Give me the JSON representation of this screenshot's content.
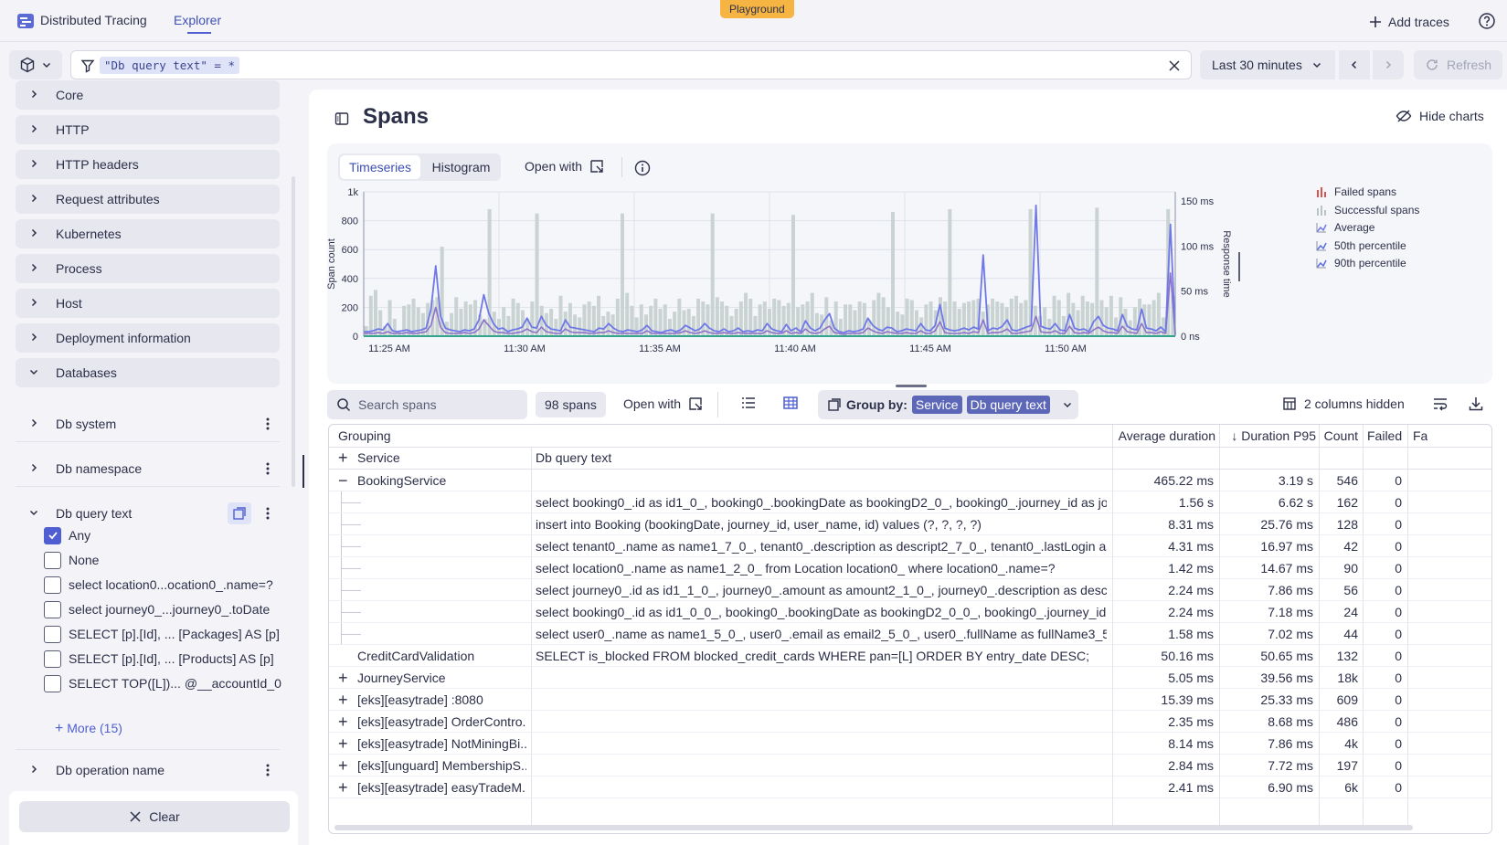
{
  "topbar": {
    "app_name": "Distributed Tracing",
    "explorer_tab": "Explorer",
    "playground": "Playground",
    "add_traces": "Add traces"
  },
  "filter": {
    "chip": "\"Db query text\" = *",
    "time_range": "Last 30 minutes",
    "refresh": "Refresh"
  },
  "sidebar": {
    "facets": [
      "Core",
      "HTTP",
      "HTTP headers",
      "Request attributes",
      "Kubernetes",
      "Process",
      "Host",
      "Deployment information",
      "Databases"
    ],
    "sub_facets": {
      "db_system": "Db system",
      "db_namespace": "Db namespace",
      "db_query_text": "Db query text",
      "db_operation_name": "Db operation name"
    },
    "query_options": [
      {
        "label": "Any",
        "checked": true
      },
      {
        "label": "None",
        "checked": false
      },
      {
        "label": "select location0...ocation0_.name=?",
        "checked": false
      },
      {
        "label": "select journey0_...journey0_.toDate",
        "checked": false
      },
      {
        "label": "SELECT [p].[Id], ... [Packages] AS [p]",
        "checked": false
      },
      {
        "label": "SELECT [p].[Id], ... [Products] AS [p]",
        "checked": false
      },
      {
        "label": "SELECT TOP([L])... @__accountId_0",
        "checked": false
      }
    ],
    "more": "More (15)",
    "clear": "Clear"
  },
  "main": {
    "title": "Spans",
    "hide_charts": "Hide charts",
    "tabs": [
      "Timeseries",
      "Histogram"
    ],
    "open_with": "Open with"
  },
  "chart_data": {
    "type": "bar",
    "left_axis": {
      "label": "Span count",
      "ticks": [
        "1k",
        "800",
        "600",
        "400",
        "200",
        "0"
      ],
      "range": [
        0,
        1000
      ]
    },
    "right_axis": {
      "label": "Response time",
      "ticks": [
        "150 ms",
        "100 ms",
        "50 ms",
        "0 ns"
      ],
      "range": [
        0,
        160
      ]
    },
    "x_ticks": [
      "11:25 AM",
      "11:30 AM",
      "11:35 AM",
      "11:40 AM",
      "11:45 AM",
      "11:50 AM"
    ],
    "grid": true,
    "legend_position": "right",
    "legend": [
      "Failed spans",
      "Successful spans",
      "Average",
      "50th percentile",
      "90th percentile"
    ],
    "colors": {
      "bars": "#c9d3d1",
      "average": "#6f78e8",
      "p50": "#8e72c9",
      "p90": "#5b6ee0",
      "failed": "#d9534f"
    },
    "series": [
      {
        "name": "Successful spans",
        "values": [
          70,
          280,
          320,
          180,
          70,
          250,
          120,
          40,
          210,
          220,
          260,
          200,
          160,
          230,
          250,
          270,
          620,
          100,
          160,
          270,
          190,
          240,
          220,
          250,
          150,
          120,
          880,
          170,
          120,
          200,
          140,
          260,
          230,
          180,
          120,
          240,
          850,
          210,
          160,
          190,
          120,
          280,
          170,
          230,
          150,
          130,
          220,
          240,
          210,
          280,
          140,
          170,
          150,
          260,
          850,
          300,
          210,
          130,
          220,
          150,
          210,
          260,
          190,
          220,
          120,
          170,
          260,
          180,
          190,
          140,
          260,
          240,
          220,
          850,
          270,
          240,
          210,
          140,
          190,
          240,
          300,
          260,
          140,
          220,
          240,
          190,
          260,
          250,
          210,
          230,
          840,
          200,
          220,
          240,
          300,
          160,
          150,
          270,
          110,
          240,
          120,
          220,
          220,
          180,
          240,
          230,
          110,
          250,
          300,
          270,
          200,
          860,
          170,
          150,
          260,
          250,
          180,
          130,
          220,
          240,
          180,
          270,
          240,
          880,
          240,
          190,
          230,
          240,
          250,
          260,
          170,
          220,
          260,
          240,
          230,
          200,
          260,
          280,
          230,
          250,
          880,
          210,
          140,
          200,
          120,
          280,
          250,
          140,
          300,
          230,
          180,
          280,
          240,
          230,
          890,
          250,
          200,
          280,
          130,
          270,
          190,
          110,
          200,
          260,
          220,
          220,
          250,
          300,
          130,
          880,
          280
        ]
      },
      {
        "name": "Average",
        "values": [
          5,
          5,
          6,
          8,
          7,
          14,
          6,
          5,
          6,
          7,
          5,
          6,
          7,
          9,
          30,
          78,
          22,
          9,
          7,
          6,
          5,
          7,
          6,
          8,
          18,
          46,
          26,
          14,
          8,
          9,
          5,
          7,
          8,
          10,
          20,
          10,
          9,
          22,
          12,
          8,
          7,
          6,
          18,
          10,
          9,
          8,
          7,
          6,
          5,
          9,
          8,
          14,
          9,
          6,
          5,
          7,
          6,
          5,
          7,
          12,
          6,
          5,
          4,
          6,
          7,
          5,
          7,
          12,
          9,
          6,
          8,
          14,
          9,
          6,
          5,
          8,
          5,
          6,
          9,
          5,
          6,
          5,
          7,
          6,
          14,
          8,
          6,
          5,
          13,
          6,
          9,
          5,
          17,
          9,
          6,
          9,
          18,
          25,
          9,
          5,
          4,
          6,
          5,
          6,
          8,
          20,
          12,
          8,
          6,
          10,
          9,
          5,
          6,
          8,
          7,
          6,
          14,
          7,
          6,
          12,
          35,
          9,
          7,
          6,
          7,
          9,
          7,
          10,
          8,
          90,
          6,
          9,
          8,
          11,
          18,
          7,
          6,
          8,
          10,
          12,
          145,
          11,
          9,
          8,
          14,
          7,
          6,
          24,
          9,
          7,
          8,
          5,
          16,
          22,
          12,
          9,
          8,
          6,
          24,
          11,
          8,
          7,
          30,
          9,
          8,
          6,
          10,
          5,
          124,
          2
        ]
      },
      {
        "name": "50th percentile",
        "values": [
          3,
          3,
          3,
          4,
          3,
          5,
          3,
          3,
          3,
          4,
          3,
          3,
          4,
          5,
          12,
          32,
          10,
          4,
          3,
          3,
          3,
          4,
          3,
          4,
          8,
          18,
          12,
          6,
          4,
          4,
          3,
          3,
          4,
          5,
          8,
          5,
          4,
          10,
          5,
          4,
          3,
          3,
          8,
          5,
          4,
          4,
          4,
          3,
          3,
          4,
          4,
          6,
          4,
          3,
          3,
          3,
          3,
          3,
          3,
          6,
          3,
          3,
          3,
          3,
          3,
          3,
          4,
          6,
          4,
          3,
          4,
          6,
          4,
          3,
          3,
          4,
          3,
          3,
          4,
          3,
          3,
          3,
          3,
          3,
          6,
          4,
          3,
          3,
          6,
          3,
          4,
          3,
          8,
          4,
          3,
          4,
          8,
          11,
          4,
          3,
          2,
          3,
          3,
          3,
          4,
          9,
          6,
          4,
          3,
          5,
          4,
          3,
          3,
          4,
          3,
          3,
          6,
          3,
          3,
          6,
          16,
          4,
          3,
          3,
          3,
          4,
          3,
          5,
          4,
          18,
          3,
          4,
          4,
          5,
          8,
          3,
          3,
          4,
          5,
          6,
          22,
          5,
          4,
          4,
          6,
          3,
          3,
          11,
          4,
          3,
          4,
          3,
          7,
          10,
          6,
          4,
          4,
          3,
          11,
          5,
          4,
          3,
          14,
          4,
          4,
          3,
          5,
          3,
          70,
          1
        ]
      }
    ]
  },
  "table_toolbar": {
    "search_placeholder": "Search spans",
    "span_count": "98 spans",
    "open_with": "Open with",
    "group_by_label": "Group by:",
    "group_by_chips": [
      "Service",
      "Db query text"
    ],
    "columns_hidden": "2 columns hidden"
  },
  "table": {
    "headers": {
      "grouping": "Grouping",
      "service": "Service",
      "db_query_text": "Db query text",
      "avg_duration": "Average duration",
      "p95": "Duration P95",
      "count": "Count",
      "failed": "Failed",
      "extra": "Fa"
    },
    "rows": [
      {
        "expander": "minus",
        "service": "BookingService",
        "query": "",
        "avg": "465.22 ms",
        "p95": "3.19 s",
        "count": "546",
        "failed": "0",
        "indent": 0
      },
      {
        "expander": "",
        "service": "",
        "query": "select booking0_.id as id1_0_, booking0_.bookingDate as bookingD2_0_, booking0_.journey_id as journ...",
        "avg": "1.56 s",
        "p95": "6.62 s",
        "count": "162",
        "failed": "0",
        "indent": 1
      },
      {
        "expander": "",
        "service": "",
        "query": "insert into Booking (bookingDate, journey_id, user_name, id) values (?, ?, ?, ?)",
        "avg": "8.31 ms",
        "p95": "25.76 ms",
        "count": "128",
        "failed": "0",
        "indent": 1
      },
      {
        "expander": "",
        "service": "",
        "query": "select tenant0_.name as name1_7_0_, tenant0_.description as descript2_7_0_, tenant0_.lastLogin as ...",
        "avg": "4.31 ms",
        "p95": "16.97 ms",
        "count": "42",
        "failed": "0",
        "indent": 1
      },
      {
        "expander": "",
        "service": "",
        "query": "select location0_.name as name1_2_0_ from Location location0_ where location0_.name=?",
        "avg": "1.42 ms",
        "p95": "14.67 ms",
        "count": "90",
        "failed": "0",
        "indent": 1
      },
      {
        "expander": "",
        "service": "",
        "query": "select journey0_.id as id1_1_0_, journey0_.amount as amount2_1_0_, journey0_.description as descri...",
        "avg": "2.24 ms",
        "p95": "7.86 ms",
        "count": "56",
        "failed": "0",
        "indent": 1
      },
      {
        "expander": "",
        "service": "",
        "query": "select booking0_.id as id1_0_0_, booking0_.bookingDate as bookingD2_0_0_, booking0_.journey_id as j...",
        "avg": "2.24 ms",
        "p95": "7.18 ms",
        "count": "24",
        "failed": "0",
        "indent": 1
      },
      {
        "expander": "",
        "service": "",
        "query": "select user0_.name as name1_5_0_, user0_.email as email2_5_0_, user0_.fullName as fullName3_5_...",
        "avg": "1.58 ms",
        "p95": "7.02 ms",
        "count": "44",
        "failed": "0",
        "indent": 1
      },
      {
        "expander": "",
        "service": "CreditCardValidation",
        "query": "SELECT is_blocked FROM blocked_credit_cards WHERE pan=[L] ORDER BY entry_date DESC;",
        "avg": "50.16 ms",
        "p95": "50.65 ms",
        "count": "132",
        "failed": "0",
        "indent": 0
      },
      {
        "expander": "plus",
        "service": "JourneyService",
        "query": "",
        "avg": "5.05 ms",
        "p95": "39.56 ms",
        "count": "18k",
        "failed": "0",
        "indent": 0
      },
      {
        "expander": "plus",
        "service": "[eks][easytrade] :8080",
        "query": "",
        "avg": "15.39 ms",
        "p95": "25.33 ms",
        "count": "609",
        "failed": "0",
        "indent": 0
      },
      {
        "expander": "plus",
        "service": "[eks][easytrade] OrderContro...",
        "query": "",
        "avg": "2.35 ms",
        "p95": "8.68 ms",
        "count": "486",
        "failed": "0",
        "indent": 0
      },
      {
        "expander": "plus",
        "service": "[eks][easytrade] NotMiningBi...",
        "query": "",
        "avg": "8.14 ms",
        "p95": "7.86 ms",
        "count": "4k",
        "failed": "0",
        "indent": 0
      },
      {
        "expander": "plus",
        "service": "[eks][unguard] MembershipS...",
        "query": "",
        "avg": "2.84 ms",
        "p95": "7.72 ms",
        "count": "197",
        "failed": "0",
        "indent": 0
      },
      {
        "expander": "plus",
        "service": "[eks][easytrade] easyTradeM...",
        "query": "",
        "avg": "2.41 ms",
        "p95": "6.90 ms",
        "count": "6k",
        "failed": "0",
        "indent": 0
      }
    ]
  }
}
